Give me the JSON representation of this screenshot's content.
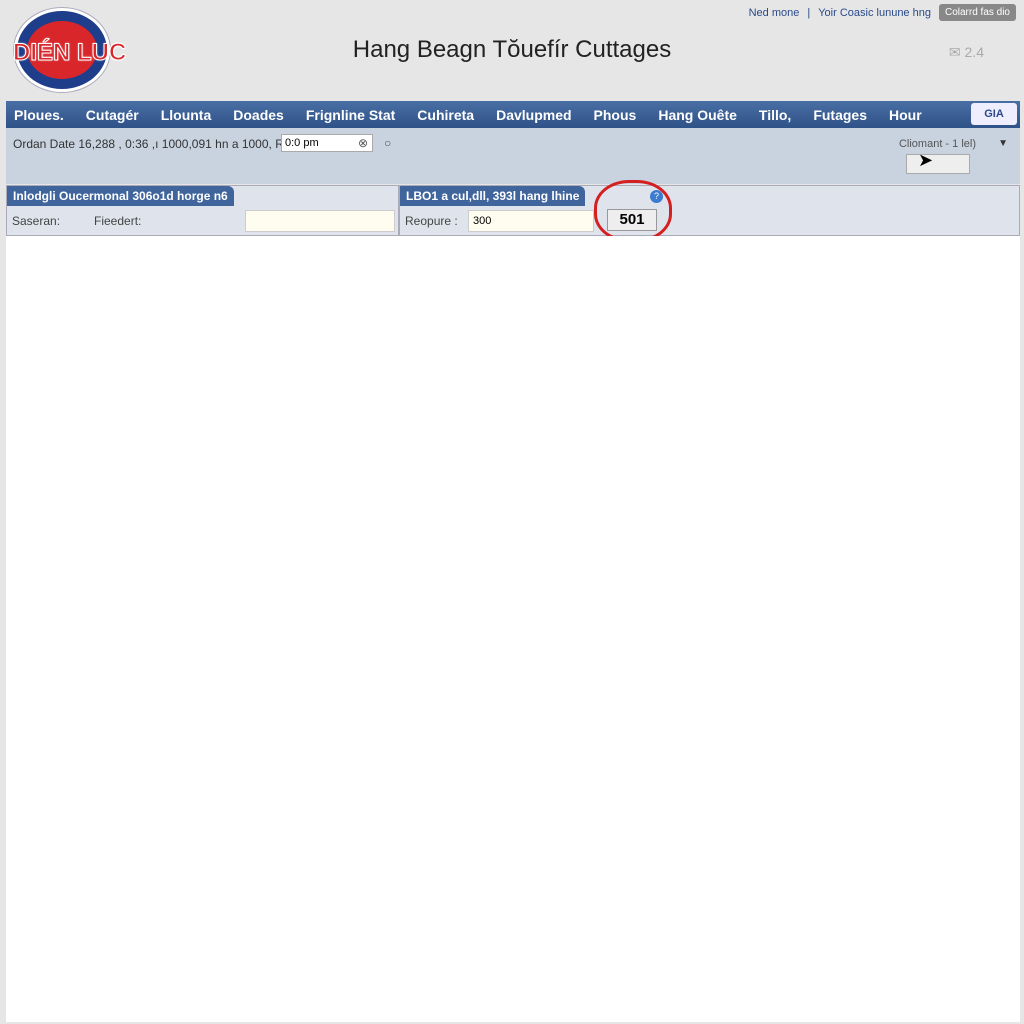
{
  "logo": {
    "text": "DIÉN LUC"
  },
  "header": {
    "title": "Hang Beagn Tŏuefír Cuttages",
    "links": [
      "Ned mone",
      "Yoir Coasic lunune hng"
    ],
    "button": "Colarrd fas dio",
    "right_text": "2.4"
  },
  "nav": {
    "items": [
      "Ploues.",
      "Cutagér",
      "Llounta",
      "Doades",
      "Frignline Stat",
      "Cuhireta",
      "Davlupmed",
      "Phous",
      "Hang Ouête",
      "Tillo,",
      "Futages",
      "Hour"
    ],
    "corner": "GIA"
  },
  "filter": {
    "label": "Ordan Date 16,288 , 0:36 ,ı 1000,091 hn a 1000, RN",
    "time_value": "0:0 pm",
    "comment_label": "Cliomant - 1 lel)"
  },
  "panel_left": {
    "header": "Inlodgli Oucermonal 306o1d horge n6",
    "field1": "Saseran:",
    "field2": "Fieedert:",
    "value": ""
  },
  "panel_right": {
    "header": "LBO1 a cul,dll, 393l hang lhine",
    "field": "Reopure :",
    "value": "300",
    "button": "501"
  }
}
